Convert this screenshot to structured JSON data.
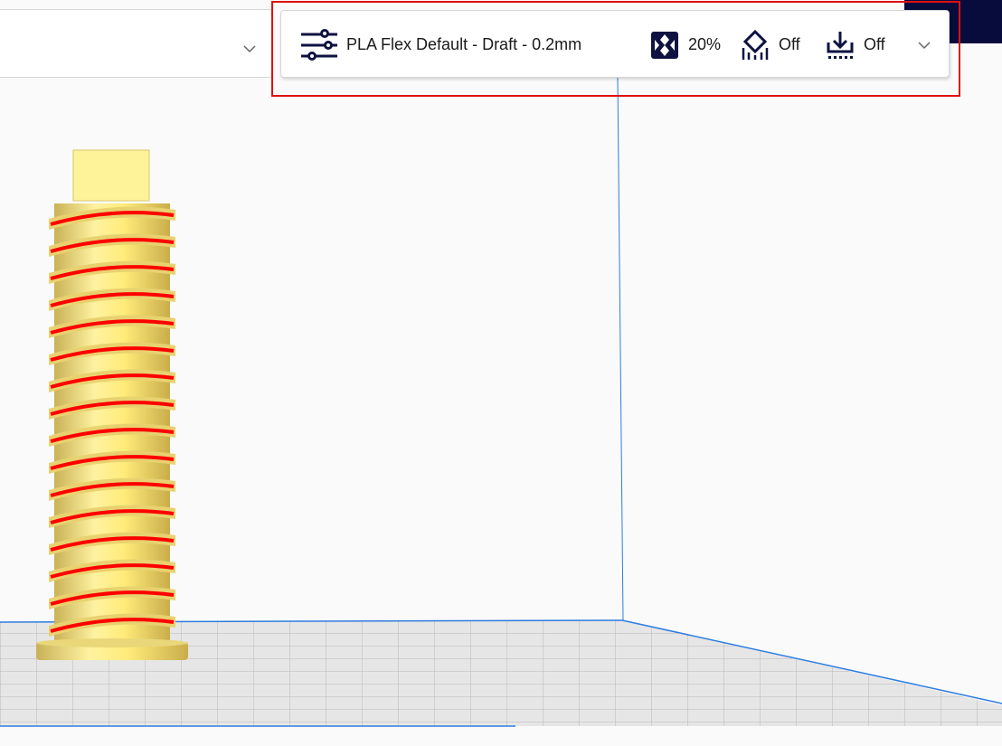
{
  "print_setup": {
    "profile": "PLA Flex Default - Draft - 0.2mm",
    "infill": "20%",
    "support": "Off",
    "adhesion": "Off"
  },
  "icons": {
    "profile": "settings-sliders-icon",
    "infill": "infill-icon",
    "support": "support-icon",
    "adhesion": "adhesion-icon",
    "expand": "chevron-down-icon"
  },
  "colors": {
    "header": "#080c3c",
    "icon": "#0d1240",
    "highlight": "#e01010",
    "model": "#f7e37a",
    "overhang": "#ff0000",
    "build_volume": "#2d7de0"
  }
}
